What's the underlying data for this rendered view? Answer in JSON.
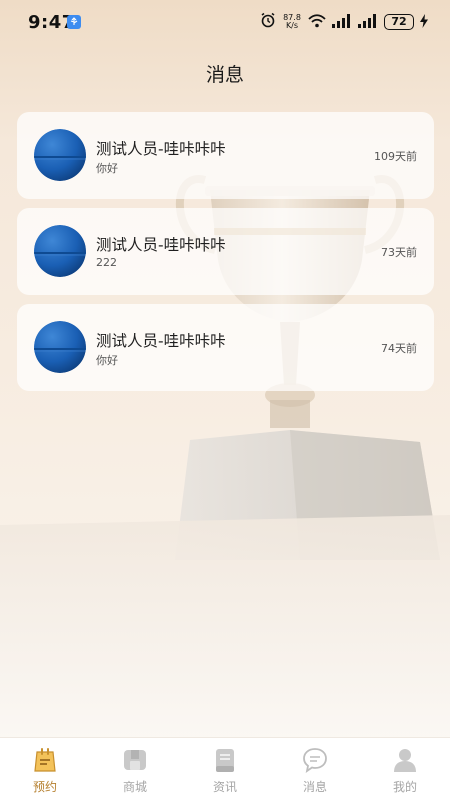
{
  "status_bar": {
    "time": "9:47",
    "net_speed_value": "87.8",
    "net_speed_unit": "K/s",
    "battery": "72"
  },
  "header": {
    "title": "消息"
  },
  "messages": [
    {
      "name": "测试人员-哇咔咔咔",
      "preview": "你好",
      "time": "109天前"
    },
    {
      "name": "测试人员-哇咔咔咔",
      "preview": "222",
      "time": "73天前"
    },
    {
      "name": "测试人员-哇咔咔咔",
      "preview": "你好",
      "time": "74天前"
    }
  ],
  "tabbar": {
    "tabs": [
      {
        "label": "预约",
        "icon": "calendar-bag-icon",
        "active": true
      },
      {
        "label": "商城",
        "icon": "shop-icon",
        "active": false
      },
      {
        "label": "资讯",
        "icon": "news-icon",
        "active": false
      },
      {
        "label": "消息",
        "icon": "chat-bubble-icon",
        "active": false
      },
      {
        "label": "我的",
        "icon": "person-icon",
        "active": false
      }
    ]
  },
  "colors": {
    "accent": "#b57f2e",
    "tab_inactive": "#a5a5a5",
    "avatar_blue": "#1a5fb4"
  }
}
